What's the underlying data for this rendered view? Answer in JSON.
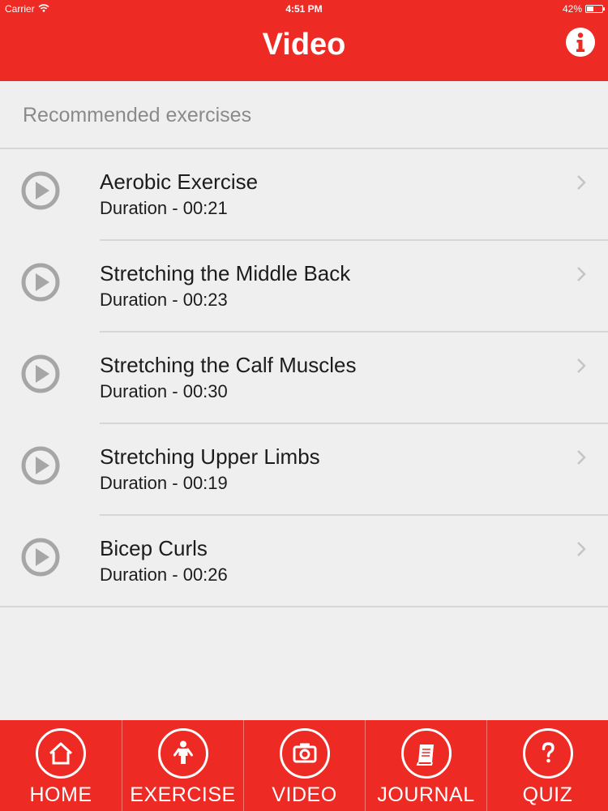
{
  "status_bar": {
    "carrier": "Carrier",
    "time": "4:51 PM",
    "battery_text": "42%",
    "battery_level": 0.42
  },
  "nav": {
    "title": "Video"
  },
  "section": {
    "title": "Recommended exercises"
  },
  "exercises": [
    {
      "title": "Aerobic Exercise",
      "duration": "Duration - 00:21"
    },
    {
      "title": "Stretching the Middle Back",
      "duration": "Duration - 00:23"
    },
    {
      "title": "Stretching the Calf Muscles",
      "duration": "Duration - 00:30"
    },
    {
      "title": "Stretching Upper Limbs",
      "duration": "Duration - 00:19"
    },
    {
      "title": "Bicep Curls",
      "duration": "Duration - 00:26"
    }
  ],
  "tabs": [
    {
      "label": "HOME",
      "icon": "home-icon"
    },
    {
      "label": "EXERCISE",
      "icon": "person-icon"
    },
    {
      "label": "VIDEO",
      "icon": "camera-icon"
    },
    {
      "label": "JOURNAL",
      "icon": "book-icon"
    },
    {
      "label": "QUIZ",
      "icon": "question-icon"
    }
  ],
  "colors": {
    "brand_red": "#ee2a24",
    "background": "#efefef",
    "icon_gray": "#a6a6a6"
  }
}
